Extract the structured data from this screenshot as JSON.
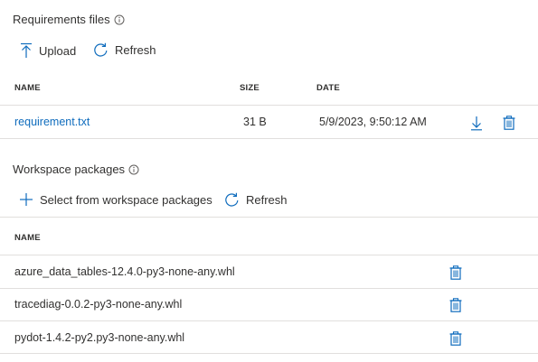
{
  "requirements": {
    "title": "Requirements files",
    "upload_label": "Upload",
    "refresh_label": "Refresh",
    "columns": {
      "name": "NAME",
      "size": "SIZE",
      "date": "DATE"
    },
    "files": [
      {
        "name": "requirement.txt",
        "size": "31 B",
        "date": "5/9/2023, 9:50:12 AM"
      }
    ]
  },
  "workspace": {
    "title": "Workspace packages",
    "select_label": "Select from workspace packages",
    "refresh_label": "Refresh",
    "columns": {
      "name": "NAME"
    },
    "packages": [
      {
        "name": "azure_data_tables-12.4.0-py3-none-any.whl"
      },
      {
        "name": "tracediag-0.0.2-py3-none-any.whl"
      },
      {
        "name": "pydot-1.4.2-py2.py3-none-any.whl"
      }
    ]
  },
  "icons": {
    "info": "info-icon",
    "upload": "upload-icon",
    "refresh": "refresh-icon",
    "download": "download-icon",
    "delete": "trash-icon",
    "add": "plus-icon"
  },
  "colors": {
    "accent": "#0f6cbd",
    "text": "#323130",
    "divider": "#e1dfdd"
  }
}
